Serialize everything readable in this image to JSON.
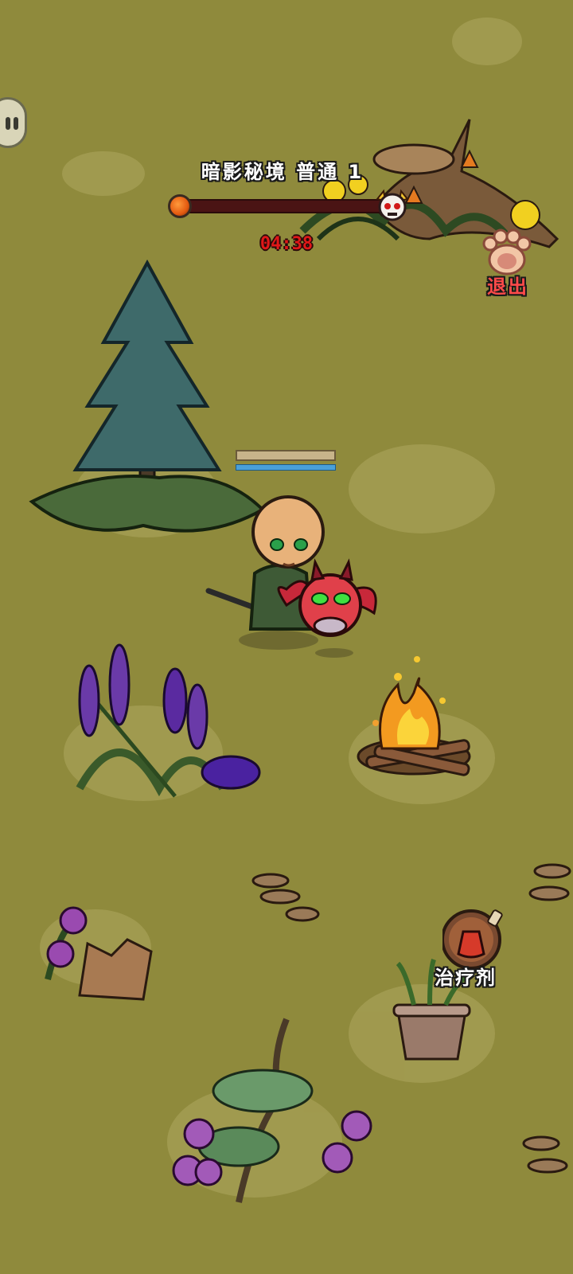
{
  "hud": {
    "stage_title": "暗影秘境 普通 1",
    "timer": "04:38",
    "progress": 0.0
  },
  "buttons": {
    "exit_label": "退出",
    "potion_label": "治疗剂"
  },
  "icons": {
    "pause": "pause-icon",
    "exit": "paw-icon",
    "potion": "potion-flask-icon",
    "boss": "boss-skull-icon",
    "progress_start": "orange-orb-icon"
  },
  "colors": {
    "ground": "#8f8a3c",
    "timer": "#e01818",
    "progress_track": "#4a1414",
    "exit_label": "#ff4a4a",
    "mana": "#4aa0d8"
  },
  "player": {
    "hp_fraction": 1.0,
    "mp_fraction": 1.0
  }
}
